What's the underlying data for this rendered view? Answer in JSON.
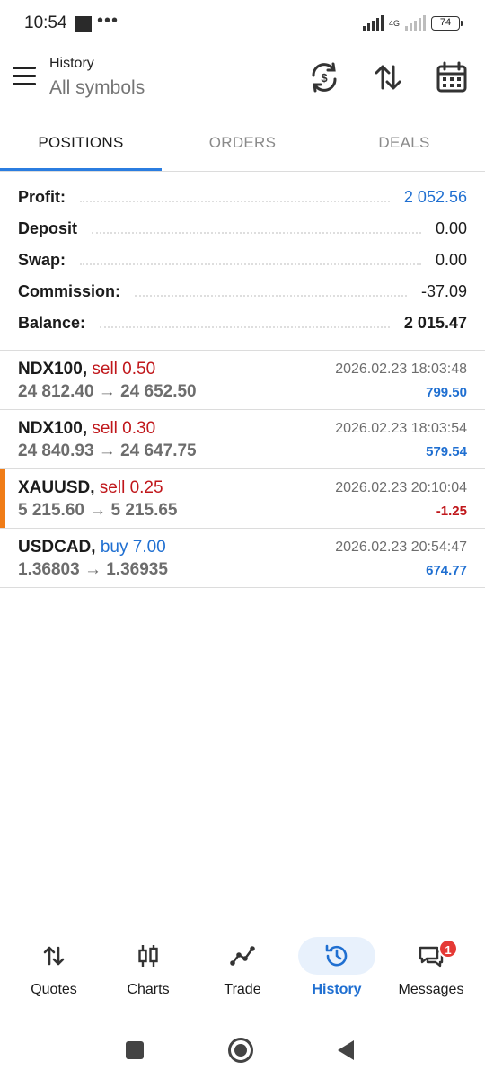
{
  "status_bar": {
    "time": "10:54",
    "dots": "•••",
    "network": "4G",
    "battery": "74"
  },
  "header": {
    "title": "History",
    "subtitle": "All symbols"
  },
  "tabs": [
    {
      "label": "POSITIONS",
      "active": true
    },
    {
      "label": "ORDERS",
      "active": false
    },
    {
      "label": "DEALS",
      "active": false
    }
  ],
  "summary": {
    "profit": {
      "label": "Profit:",
      "value": "2 052.56"
    },
    "deposit": {
      "label": "Deposit",
      "value": "0.00"
    },
    "swap": {
      "label": "Swap:",
      "value": "0.00"
    },
    "commission": {
      "label": "Commission:",
      "value": "-37.09"
    },
    "balance": {
      "label": "Balance:",
      "value": "2 015.47"
    }
  },
  "positions": [
    {
      "symbol": "NDX100,",
      "side": "sell 0.50",
      "prices": "24 812.40 → 24 652.50",
      "time": "2026.02.23 18:03:48",
      "profit": "799.50"
    },
    {
      "symbol": "NDX100,",
      "side": "sell 0.30",
      "prices": "24 840.93 → 24 647.75",
      "time": "2026.02.23 18:03:54",
      "profit": "579.54"
    },
    {
      "symbol": "XAUUSD,",
      "side": "sell 0.25",
      "prices": "5 215.60 → 5 215.65",
      "time": "2026.02.23 20:10:04",
      "profit": "-1.25"
    },
    {
      "symbol": "USDCAD,",
      "side": "buy 7.00",
      "prices": "1.36803 → 1.36935",
      "time": "2026.02.23 20:54:47",
      "profit": "674.77"
    }
  ],
  "bottom_nav": [
    {
      "label": "Quotes",
      "icon": "quotes-arrows-icon",
      "active": false
    },
    {
      "label": "Charts",
      "icon": "candlestick-icon",
      "active": false
    },
    {
      "label": "Trade",
      "icon": "trade-line-icon",
      "active": false
    },
    {
      "label": "History",
      "icon": "history-clock-icon",
      "active": true
    },
    {
      "label": "Messages",
      "icon": "messages-icon",
      "active": false,
      "badge": "1"
    }
  ],
  "colors": {
    "accent": "#1f6fd1",
    "sell": "#c0171b",
    "marker": "#f07c17"
  }
}
